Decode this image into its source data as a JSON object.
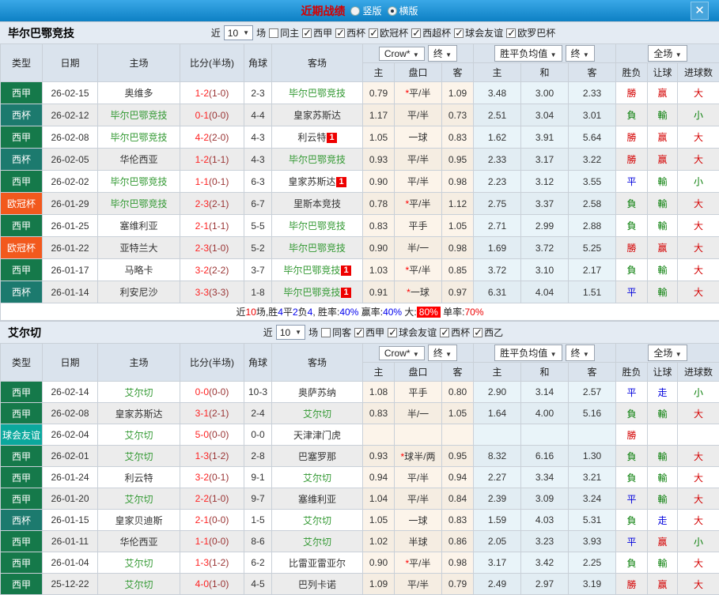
{
  "titlebar": {
    "title": "近期战绩",
    "radio_vertical": {
      "label": "竖版",
      "checked": false
    },
    "radio_horizontal": {
      "label": "横版",
      "checked": true
    },
    "close_glyph": "✕"
  },
  "table_header": {
    "type": "类型",
    "date": "日期",
    "home": "主场",
    "score": "比分(半场)",
    "corner": "角球",
    "away": "客场",
    "odds_select": "Crow*",
    "final_select": "终",
    "mean_select": "胜平负均值",
    "final_select2": "终",
    "scope_select": "全场",
    "sub": [
      "主",
      "盘口",
      "客",
      "主",
      "和",
      "客",
      "胜负",
      "让球",
      "进球数"
    ]
  },
  "colors": {
    "liga": "#15794a",
    "cup": "#1c7a6e",
    "ucl": "#f2591d",
    "friendly": "#0ba89d",
    "win": "#d40000",
    "lose": "#067d06",
    "draw": "#0000dd",
    "accent_blue": "#0d80c4"
  },
  "sections": [
    {
      "team": "毕尔巴鄂竞技",
      "filters": {
        "prefix": "近",
        "count": "10",
        "suffix": "场",
        "same": {
          "label": "同主",
          "checked": false
        },
        "leagues": [
          {
            "label": "西甲",
            "checked": true
          },
          {
            "label": "西杯",
            "checked": true
          },
          {
            "label": "欧冠杯",
            "checked": true
          },
          {
            "label": "西超杯",
            "checked": true
          },
          {
            "label": "球会友谊",
            "checked": true
          },
          {
            "label": "欧罗巴杯",
            "checked": true
          }
        ]
      },
      "rows": [
        {
          "type": "西甲",
          "tc": "liga",
          "date": "26-02-15",
          "home": "奥维多",
          "hg": 0,
          "hb": 0,
          "score": "1-2",
          "half": "(1-0)",
          "corner": "2-3",
          "away": "毕尔巴鄂竞技",
          "ag": 1,
          "ab": 0,
          "o": [
            "0.79",
            "*平/半",
            "1.09"
          ],
          "m": [
            "3.48",
            "3.00",
            "2.33"
          ],
          "r": [
            [
              "勝",
              "w"
            ],
            [
              "赢",
              "w"
            ],
            [
              "大",
              "w"
            ]
          ]
        },
        {
          "type": "西杯",
          "tc": "cup",
          "date": "26-02-12",
          "home": "毕尔巴鄂竞技",
          "hg": 1,
          "hb": 0,
          "score": "0-1",
          "half": "(0-0)",
          "corner": "4-4",
          "away": "皇家苏斯达",
          "ag": 0,
          "ab": 0,
          "o": [
            "1.17",
            "平/半",
            "0.73"
          ],
          "m": [
            "2.51",
            "3.04",
            "3.01"
          ],
          "r": [
            [
              "負",
              "l"
            ],
            [
              "輸",
              "l"
            ],
            [
              "小",
              "l"
            ]
          ]
        },
        {
          "type": "西甲",
          "tc": "liga",
          "date": "26-02-08",
          "home": "毕尔巴鄂竞技",
          "hg": 1,
          "hb": 0,
          "score": "4-2",
          "half": "(2-0)",
          "corner": "4-3",
          "away": "利云特",
          "ag": 0,
          "ab": 1,
          "o": [
            "1.05",
            "一球",
            "0.83"
          ],
          "m": [
            "1.62",
            "3.91",
            "5.64"
          ],
          "r": [
            [
              "勝",
              "w"
            ],
            [
              "赢",
              "w"
            ],
            [
              "大",
              "w"
            ]
          ]
        },
        {
          "type": "西杯",
          "tc": "cup",
          "date": "26-02-05",
          "home": "华伦西亚",
          "hg": 0,
          "hb": 0,
          "score": "1-2",
          "half": "(1-1)",
          "corner": "4-3",
          "away": "毕尔巴鄂竞技",
          "ag": 1,
          "ab": 0,
          "o": [
            "0.93",
            "平/半",
            "0.95"
          ],
          "m": [
            "2.33",
            "3.17",
            "3.22"
          ],
          "r": [
            [
              "勝",
              "w"
            ],
            [
              "赢",
              "w"
            ],
            [
              "大",
              "w"
            ]
          ]
        },
        {
          "type": "西甲",
          "tc": "liga",
          "date": "26-02-02",
          "home": "毕尔巴鄂竞技",
          "hg": 1,
          "hb": 0,
          "score": "1-1",
          "half": "(0-1)",
          "corner": "6-3",
          "away": "皇家苏斯达",
          "ag": 0,
          "ab": 1,
          "o": [
            "0.90",
            "平/半",
            "0.98"
          ],
          "m": [
            "2.23",
            "3.12",
            "3.55"
          ],
          "r": [
            [
              "平",
              "d"
            ],
            [
              "輸",
              "l"
            ],
            [
              "小",
              "l"
            ]
          ]
        },
        {
          "type": "欧冠杯",
          "tc": "ucl",
          "date": "26-01-29",
          "home": "毕尔巴鄂竞技",
          "hg": 1,
          "hb": 0,
          "score": "2-3",
          "half": "(2-1)",
          "corner": "6-7",
          "away": "里斯本竞技",
          "ag": 0,
          "ab": 0,
          "o": [
            "0.78",
            "*平/半",
            "1.12"
          ],
          "m": [
            "2.75",
            "3.37",
            "2.58"
          ],
          "r": [
            [
              "負",
              "l"
            ],
            [
              "輸",
              "l"
            ],
            [
              "大",
              "w"
            ]
          ]
        },
        {
          "type": "西甲",
          "tc": "liga",
          "date": "26-01-25",
          "home": "塞维利亚",
          "hg": 0,
          "hb": 0,
          "score": "2-1",
          "half": "(1-1)",
          "corner": "5-5",
          "away": "毕尔巴鄂竞技",
          "ag": 1,
          "ab": 0,
          "o": [
            "0.83",
            "平手",
            "1.05"
          ],
          "m": [
            "2.71",
            "2.99",
            "2.88"
          ],
          "r": [
            [
              "負",
              "l"
            ],
            [
              "輸",
              "l"
            ],
            [
              "大",
              "w"
            ]
          ]
        },
        {
          "type": "欧冠杯",
          "tc": "ucl",
          "date": "26-01-22",
          "home": "亚特兰大",
          "hg": 0,
          "hb": 0,
          "score": "2-3",
          "half": "(1-0)",
          "corner": "5-2",
          "away": "毕尔巴鄂竞技",
          "ag": 1,
          "ab": 0,
          "o": [
            "0.90",
            "半/一",
            "0.98"
          ],
          "m": [
            "1.69",
            "3.72",
            "5.25"
          ],
          "r": [
            [
              "勝",
              "w"
            ],
            [
              "赢",
              "w"
            ],
            [
              "大",
              "w"
            ]
          ]
        },
        {
          "type": "西甲",
          "tc": "liga",
          "date": "26-01-17",
          "home": "马略卡",
          "hg": 0,
          "hb": 0,
          "score": "3-2",
          "half": "(2-2)",
          "corner": "3-7",
          "away": "毕尔巴鄂竞技",
          "ag": 1,
          "ab": 1,
          "o": [
            "1.03",
            "*平/半",
            "0.85"
          ],
          "m": [
            "3.72",
            "3.10",
            "2.17"
          ],
          "r": [
            [
              "負",
              "l"
            ],
            [
              "輸",
              "l"
            ],
            [
              "大",
              "w"
            ]
          ]
        },
        {
          "type": "西杯",
          "tc": "cup",
          "date": "26-01-14",
          "home": "利安尼沙",
          "hg": 0,
          "hb": 0,
          "score": "3-3",
          "half": "(3-3)",
          "corner": "1-8",
          "away": "毕尔巴鄂竞技",
          "ag": 1,
          "ab": 1,
          "o": [
            "0.91",
            "*一球",
            "0.97"
          ],
          "m": [
            "6.31",
            "4.04",
            "1.51"
          ],
          "r": [
            [
              "平",
              "d"
            ],
            [
              "輸",
              "l"
            ],
            [
              "大",
              "w"
            ]
          ]
        }
      ],
      "summary": [
        [
          "近",
          "k"
        ],
        [
          "10",
          "r"
        ],
        [
          "场,胜",
          "k"
        ],
        [
          "4",
          "b"
        ],
        [
          "平",
          "k"
        ],
        [
          "2",
          "b"
        ],
        [
          "负",
          "k"
        ],
        [
          "4",
          "b"
        ],
        [
          ", 胜率:",
          "k"
        ],
        [
          "40%",
          "b"
        ],
        [
          " 赢率:",
          "k"
        ],
        [
          "40%",
          "b"
        ],
        [
          " 大:",
          "k"
        ],
        [
          "80%",
          "rb"
        ],
        [
          " 单率:",
          "k"
        ],
        [
          "70%",
          "r"
        ]
      ]
    },
    {
      "team": "艾尔切",
      "filters": {
        "prefix": "近",
        "count": "10",
        "suffix": "场",
        "same": {
          "label": "同客",
          "checked": false
        },
        "leagues": [
          {
            "label": "西甲",
            "checked": true
          },
          {
            "label": "球会友谊",
            "checked": true
          },
          {
            "label": "西杯",
            "checked": true
          },
          {
            "label": "西乙",
            "checked": true
          }
        ]
      },
      "rows": [
        {
          "type": "西甲",
          "tc": "liga",
          "date": "26-02-14",
          "home": "艾尔切",
          "hg": 1,
          "hb": 0,
          "score": "0-0",
          "half": "(0-0)",
          "corner": "10-3",
          "away": "奥萨苏纳",
          "ag": 0,
          "ab": 0,
          "o": [
            "1.08",
            "平手",
            "0.80"
          ],
          "m": [
            "2.90",
            "3.14",
            "2.57"
          ],
          "r": [
            [
              "平",
              "d"
            ],
            [
              "走",
              "d"
            ],
            [
              "小",
              "l"
            ]
          ]
        },
        {
          "type": "西甲",
          "tc": "liga",
          "date": "26-02-08",
          "home": "皇家苏斯达",
          "hg": 0,
          "hb": 0,
          "score": "3-1",
          "half": "(2-1)",
          "corner": "2-4",
          "away": "艾尔切",
          "ag": 1,
          "ab": 0,
          "o": [
            "0.83",
            "半/一",
            "1.05"
          ],
          "m": [
            "1.64",
            "4.00",
            "5.16"
          ],
          "r": [
            [
              "負",
              "l"
            ],
            [
              "輸",
              "l"
            ],
            [
              "大",
              "w"
            ]
          ]
        },
        {
          "type": "球会友谊",
          "tc": "friendly",
          "date": "26-02-04",
          "home": "艾尔切",
          "hg": 1,
          "hb": 0,
          "score": "5-0",
          "half": "(0-0)",
          "corner": "0-0",
          "away": "天津津门虎",
          "ag": 0,
          "ab": 0,
          "o": [
            "",
            "",
            ""
          ],
          "m": [
            "",
            "",
            ""
          ],
          "r": [
            [
              "勝",
              "w"
            ],
            [
              "",
              ""
            ],
            [
              "",
              ""
            ]
          ]
        },
        {
          "type": "西甲",
          "tc": "liga",
          "date": "26-02-01",
          "home": "艾尔切",
          "hg": 1,
          "hb": 0,
          "score": "1-3",
          "half": "(1-2)",
          "corner": "2-8",
          "away": "巴塞罗那",
          "ag": 0,
          "ab": 0,
          "o": [
            "0.93",
            "*球半/两",
            "0.95"
          ],
          "m": [
            "8.32",
            "6.16",
            "1.30"
          ],
          "r": [
            [
              "負",
              "l"
            ],
            [
              "輸",
              "l"
            ],
            [
              "大",
              "w"
            ]
          ]
        },
        {
          "type": "西甲",
          "tc": "liga",
          "date": "26-01-24",
          "home": "利云特",
          "hg": 0,
          "hb": 0,
          "score": "3-2",
          "half": "(0-1)",
          "corner": "9-1",
          "away": "艾尔切",
          "ag": 1,
          "ab": 0,
          "o": [
            "0.94",
            "平/半",
            "0.94"
          ],
          "m": [
            "2.27",
            "3.34",
            "3.21"
          ],
          "r": [
            [
              "負",
              "l"
            ],
            [
              "輸",
              "l"
            ],
            [
              "大",
              "w"
            ]
          ]
        },
        {
          "type": "西甲",
          "tc": "liga",
          "date": "26-01-20",
          "home": "艾尔切",
          "hg": 1,
          "hb": 0,
          "score": "2-2",
          "half": "(1-0)",
          "corner": "9-7",
          "away": "塞维利亚",
          "ag": 0,
          "ab": 0,
          "o": [
            "1.04",
            "平/半",
            "0.84"
          ],
          "m": [
            "2.39",
            "3.09",
            "3.24"
          ],
          "r": [
            [
              "平",
              "d"
            ],
            [
              "輸",
              "l"
            ],
            [
              "大",
              "w"
            ]
          ]
        },
        {
          "type": "西杯",
          "tc": "cup",
          "date": "26-01-15",
          "home": "皇家贝迪斯",
          "hg": 0,
          "hb": 0,
          "score": "2-1",
          "half": "(0-0)",
          "corner": "1-5",
          "away": "艾尔切",
          "ag": 1,
          "ab": 0,
          "o": [
            "1.05",
            "一球",
            "0.83"
          ],
          "m": [
            "1.59",
            "4.03",
            "5.31"
          ],
          "r": [
            [
              "負",
              "l"
            ],
            [
              "走",
              "d"
            ],
            [
              "大",
              "w"
            ]
          ]
        },
        {
          "type": "西甲",
          "tc": "liga",
          "date": "26-01-11",
          "home": "华伦西亚",
          "hg": 0,
          "hb": 0,
          "score": "1-1",
          "half": "(0-0)",
          "corner": "8-6",
          "away": "艾尔切",
          "ag": 1,
          "ab": 0,
          "o": [
            "1.02",
            "半球",
            "0.86"
          ],
          "m": [
            "2.05",
            "3.23",
            "3.93"
          ],
          "r": [
            [
              "平",
              "d"
            ],
            [
              "赢",
              "w"
            ],
            [
              "小",
              "l"
            ]
          ]
        },
        {
          "type": "西甲",
          "tc": "liga",
          "date": "26-01-04",
          "home": "艾尔切",
          "hg": 1,
          "hb": 0,
          "score": "1-3",
          "half": "(1-2)",
          "corner": "6-2",
          "away": "比雷亚雷亚尔",
          "ag": 0,
          "ab": 0,
          "o": [
            "0.90",
            "*平/半",
            "0.98"
          ],
          "m": [
            "3.17",
            "3.42",
            "2.25"
          ],
          "r": [
            [
              "負",
              "l"
            ],
            [
              "輸",
              "l"
            ],
            [
              "大",
              "w"
            ]
          ]
        },
        {
          "type": "西甲",
          "tc": "liga",
          "date": "25-12-22",
          "home": "艾尔切",
          "hg": 1,
          "hb": 0,
          "score": "4-0",
          "half": "(1-0)",
          "corner": "4-5",
          "away": "巴列卡诺",
          "ag": 0,
          "ab": 0,
          "o": [
            "1.09",
            "平/半",
            "0.79"
          ],
          "m": [
            "2.49",
            "2.97",
            "3.19"
          ],
          "r": [
            [
              "勝",
              "w"
            ],
            [
              "赢",
              "w"
            ],
            [
              "大",
              "w"
            ]
          ]
        }
      ],
      "summary": null
    }
  ]
}
